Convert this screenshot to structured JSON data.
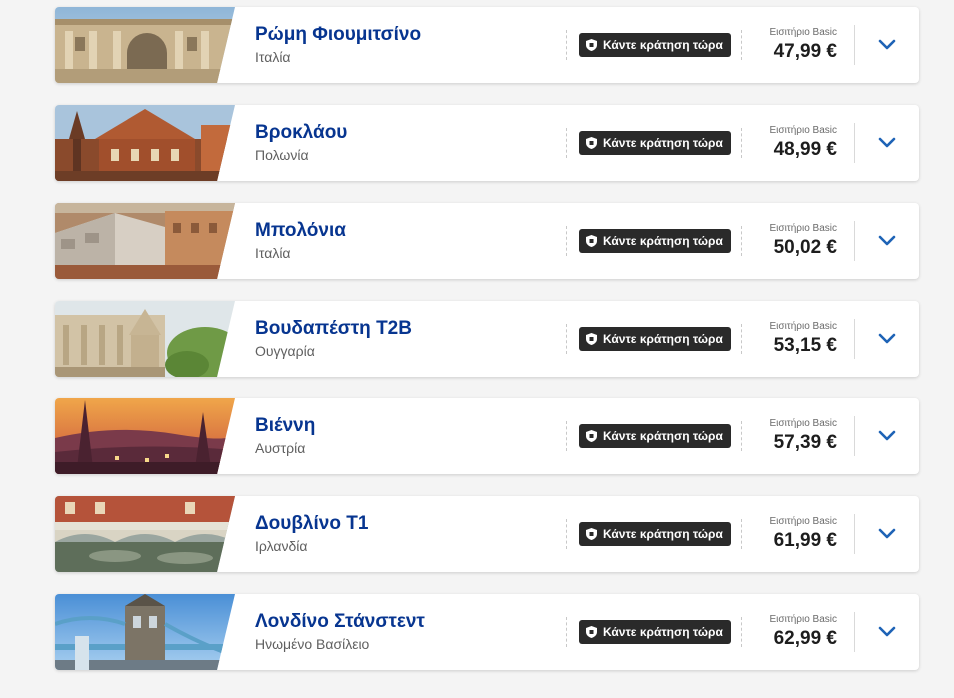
{
  "colors": {
    "city": "#073590",
    "button_bg": "#2a2a2a",
    "chevron": "#1e63b6",
    "page_bg": "#f4f4f4"
  },
  "destinations": [
    {
      "city": "Ρώμη Φιουμιτσίνο",
      "country": "Ιταλία",
      "button_label": "Κάντε κράτηση τώρα",
      "fare_label": "Εισιτήριο Basic",
      "price": "47,99 €",
      "image": "rome-building-photo"
    },
    {
      "city": "Βροκλάου",
      "country": "Πολωνία",
      "button_label": "Κάντε κράτηση τώρα",
      "fare_label": "Εισιτήριο Basic",
      "price": "48,99 €",
      "image": "wroclaw-town-hall-photo"
    },
    {
      "city": "Μπολόνια",
      "country": "Ιταλία",
      "button_label": "Κάντε κράτηση τώρα",
      "fare_label": "Εισιτήριο Basic",
      "price": "50,02 €",
      "image": "bologna-rooftops-photo"
    },
    {
      "city": "Βουδαπέστη T2B",
      "country": "Ουγγαρία",
      "button_label": "Κάντε κράτηση τώρα",
      "fare_label": "Εισιτήριο Basic",
      "price": "53,15 €",
      "image": "budapest-fishermans-bastion-photo"
    },
    {
      "city": "Βιέννη",
      "country": "Αυστρία",
      "button_label": "Κάντε κράτηση τώρα",
      "fare_label": "Εισιτήριο Basic",
      "price": "57,39 €",
      "image": "vienna-sunset-photo"
    },
    {
      "city": "Δουβλίνο T1",
      "country": "Ιρλανδία",
      "button_label": "Κάντε κράτηση τώρα",
      "fare_label": "Εισιτήριο Basic",
      "price": "61,99 €",
      "image": "dublin-bridge-photo"
    },
    {
      "city": "Λονδίνο Στάνστεντ",
      "country": "Ηνωμένο Βασίλειο",
      "button_label": "Κάντε κράτηση τώρα",
      "fare_label": "Εισιτήριο Basic",
      "price": "62,99 €",
      "image": "london-tower-bridge-photo"
    }
  ]
}
